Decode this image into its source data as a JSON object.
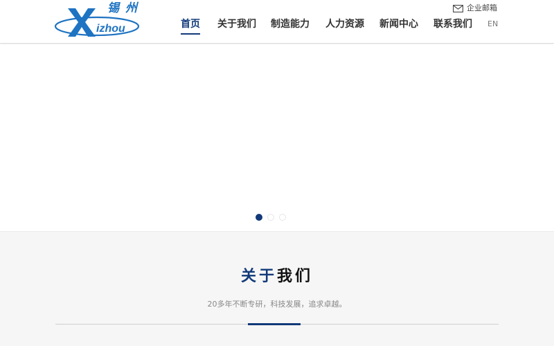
{
  "header": {
    "logo_text": "izhou",
    "logo_letter": "X",
    "logo_chinese": "锡州",
    "mailbox_label": "企业邮箱",
    "mailbox_icon": "envelope-icon",
    "nav": [
      {
        "label": "首页",
        "active": true
      },
      {
        "label": "关于我们",
        "active": false
      },
      {
        "label": "制造能力",
        "active": false
      },
      {
        "label": "人力资源",
        "active": false
      },
      {
        "label": "新闻中心",
        "active": false
      },
      {
        "label": "联系我们",
        "active": false
      }
    ],
    "lang_label": "EN"
  },
  "banner": {
    "slide_count": 3,
    "active_slide": 1
  },
  "about": {
    "title_highlight": "关于",
    "title_rest": "我们",
    "subtitle": "20多年不断专研，科技发展，追求卓越。"
  },
  "colors": {
    "brand_navy": "#123a7a",
    "logo_blue": "#1e73c2",
    "section_bg": "#f6f6f6"
  }
}
